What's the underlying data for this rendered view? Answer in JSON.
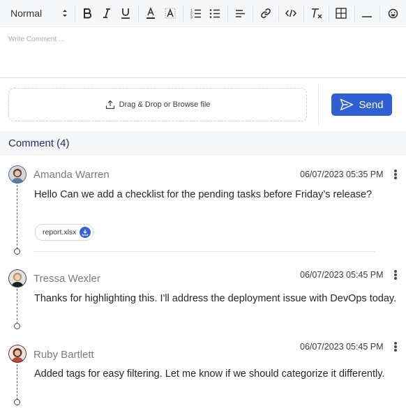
{
  "toolbar": {
    "format_select": "Normal",
    "buttons": [
      "bold-icon",
      "italic-icon",
      "underline-icon",
      "text-color-icon",
      "highlight-icon",
      "ordered-list-icon",
      "bullet-list-icon",
      "align-icon",
      "link-icon",
      "code-icon",
      "clear-format-icon",
      "table-icon",
      "horizontal-rule-icon",
      "emoji-icon"
    ]
  },
  "editor": {
    "placeholder": "Write Comment ..."
  },
  "upload": {
    "label": "Drag & Drop or Browse file"
  },
  "send": {
    "label": "Send"
  },
  "comments": {
    "header": "Comment (4)",
    "items": [
      {
        "name": "Amanda Warren",
        "date": "06/07/2023 05:35 PM",
        "text": "Hello Can we add a checklist for the pending tasks before Friday’s release?",
        "attachment": "report.xlsx"
      },
      {
        "name": "Tressa Wexler",
        "date": "06/07/2023 05:45 PM",
        "text": "Thanks for highlighting this. I'll address the deployment issue with DevOps today."
      },
      {
        "name": "Ruby Bartlett",
        "date": "06/07/2023 05:45 PM",
        "text": "Added tags for easy filtering. Let me know if we should categorize it differently."
      }
    ]
  },
  "colors": {
    "accent": "#2f5fd0",
    "header_bg": "#f5f6f8",
    "toolbar_bg": "#f6f7f9"
  }
}
